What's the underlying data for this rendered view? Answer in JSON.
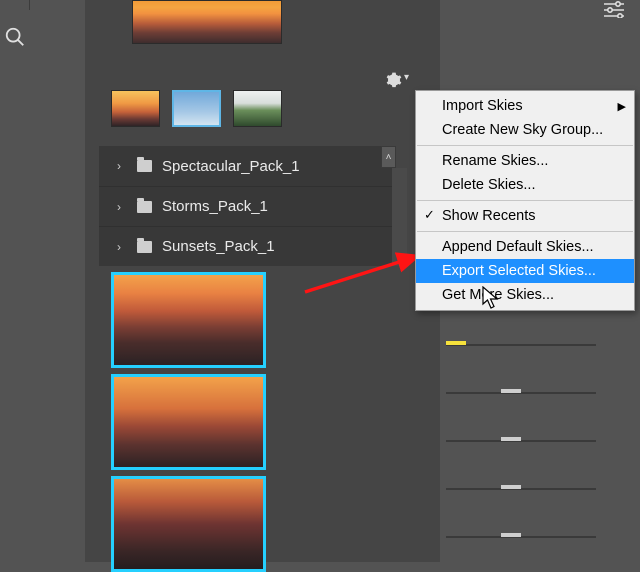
{
  "colors": {
    "selection": "#25d0ff",
    "menu_highlight": "#1e90ff",
    "panel": "#454545"
  },
  "recents": [
    {
      "name": "sunset-thumb",
      "selected": false
    },
    {
      "name": "blue-sky-thumb",
      "selected": true
    },
    {
      "name": "field-thumb",
      "selected": false
    }
  ],
  "folders": [
    {
      "label": "Spectacular_Pack_1"
    },
    {
      "label": "Storms_Pack_1"
    },
    {
      "label": "Sunsets_Pack_1"
    }
  ],
  "selected_thumbs": [
    {
      "name": "sunset-1"
    },
    {
      "name": "sunset-2"
    },
    {
      "name": "sunset-3"
    }
  ],
  "menu": {
    "items": [
      {
        "label": "Import Skies",
        "submenu": true
      },
      {
        "label": "Create New Sky Group..."
      },
      {
        "label": "Rename Skies..."
      },
      {
        "label": "Delete Skies..."
      },
      {
        "label": "Show Recents",
        "checked": true
      },
      {
        "label": "Append Default Skies..."
      },
      {
        "label": "Export Selected Skies...",
        "highlight": true
      },
      {
        "label": "Get More Skies..."
      }
    ]
  }
}
